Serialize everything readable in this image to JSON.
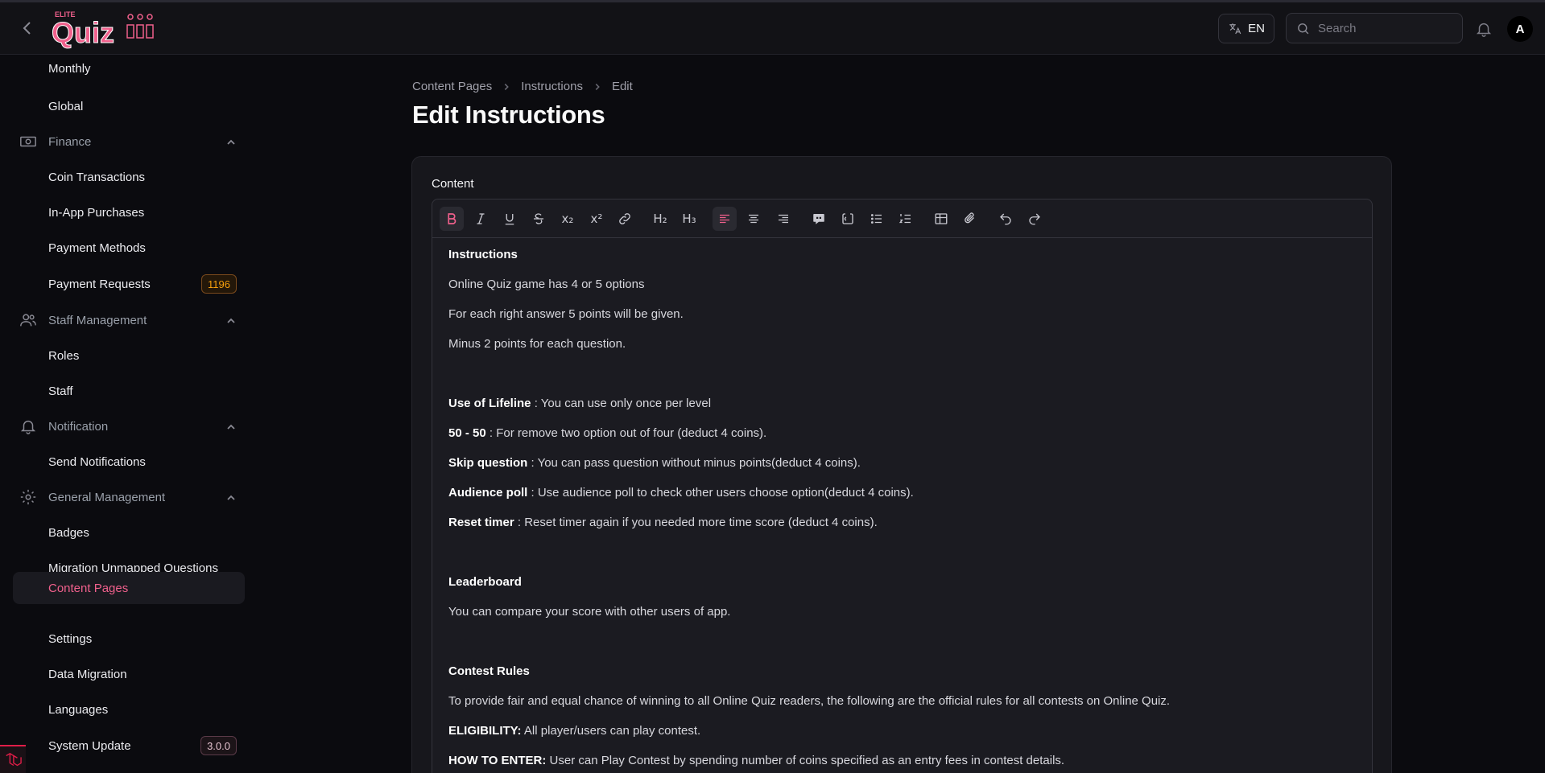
{
  "app": {
    "logo_small": "ELITE",
    "logo_text": "Quiz"
  },
  "topbar": {
    "lang": "EN",
    "search_placeholder": "Search",
    "avatar_initial": "A"
  },
  "sidebar": {
    "items": [
      {
        "label": "Monthly"
      },
      {
        "label": "Global"
      },
      {
        "label": "Finance",
        "group": true,
        "icon": "banknote-icon"
      },
      {
        "label": "Coin Transactions"
      },
      {
        "label": "In-App Purchases"
      },
      {
        "label": "Payment Methods"
      },
      {
        "label": "Payment Requests",
        "badge": "1196"
      },
      {
        "label": "Staff Management",
        "group": true,
        "icon": "users-icon"
      },
      {
        "label": "Roles"
      },
      {
        "label": "Staff"
      },
      {
        "label": "Notification",
        "group": true,
        "icon": "bell-icon"
      },
      {
        "label": "Send Notifications"
      },
      {
        "label": "General Management",
        "group": true,
        "icon": "gear-icon"
      },
      {
        "label": "Badges"
      },
      {
        "label": "Migration Unmapped Questions"
      },
      {
        "label": "Content Pages",
        "active": true
      },
      {
        "label": "Settings"
      },
      {
        "label": "Data Migration"
      },
      {
        "label": "Languages"
      },
      {
        "label": "System Update",
        "badge": "3.0.0"
      }
    ]
  },
  "breadcrumb": [
    "Content Pages",
    "Instructions",
    "Edit"
  ],
  "page_title": "Edit Instructions",
  "form": {
    "field_label": "Content"
  },
  "toolbar": {
    "buttons": [
      "bold",
      "italic",
      "underline",
      "strike",
      "subscript",
      "superscript",
      "link",
      "h2",
      "h3",
      "align-left",
      "align-center",
      "align-right",
      "blockquote",
      "code-block",
      "bullet-list",
      "ordered-list",
      "table",
      "attach",
      "undo",
      "redo"
    ],
    "h2": "H₂",
    "h3": "H₃",
    "sub": "x₂",
    "sup": "x²"
  },
  "content": {
    "l1_bold": "Instructions",
    "l2": "Online Quiz game has 4 or 5 options",
    "l3": "For each right answer 5 points will be given.",
    "l4": "Minus 2 points for each question.",
    "l5_bold": "Use of Lifeline",
    "l5_rest": " : You can use only once per level",
    "l6_bold": "50 - 50",
    "l6_rest": " : For remove two option out of four (deduct 4 coins).",
    "l7_bold": "Skip question",
    "l7_rest": " : You can pass question without minus points(deduct 4 coins).",
    "l8_bold": "Audience poll",
    "l8_rest": " : Use audience poll to check other users choose option(deduct 4 coins).",
    "l9_bold": "Reset timer",
    "l9_rest": " : Reset timer again if you needed more time score (deduct 4 coins).",
    "l10_bold": "Leaderboard",
    "l11": "You can compare your score with other users of app.",
    "l12_bold": "Contest Rules",
    "l13": "To provide fair and equal chance of winning to all Online Quiz readers, the following are the official rules for all contests on Online Quiz.",
    "l14_bold": "ELIGIBILITY:",
    "l14_rest": " All player/users can play contest.",
    "l15_bold": "HOW TO ENTER:",
    "l15_rest": " User can Play Contest by spending number of coins specified as an entry fees in contest details."
  },
  "colors": {
    "accent": "#f0608c",
    "background": "#0b0b0f",
    "card": "#17171c"
  }
}
